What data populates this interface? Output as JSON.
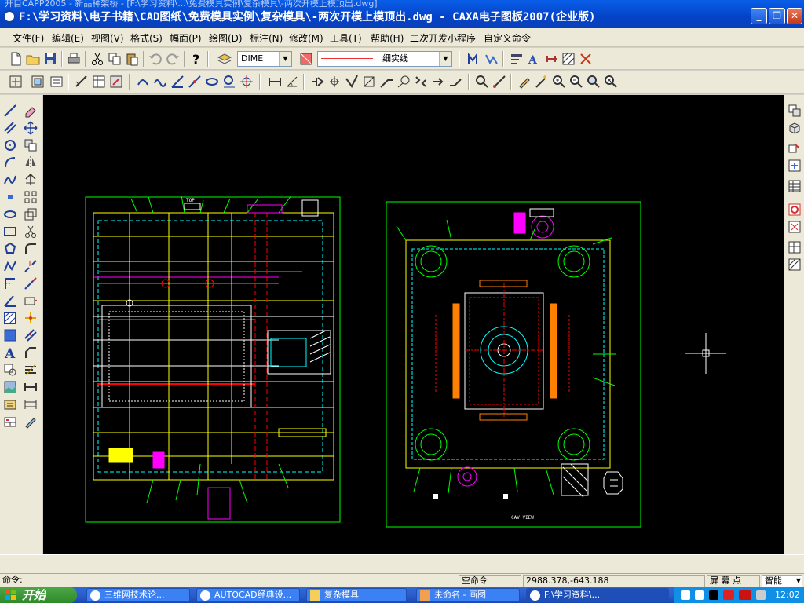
{
  "window": {
    "ghost_title": "开目CAPP2005 - 新品种架桥 - [F:\\学习资料\\...\\免费模具实例\\复杂模具\\-两次开模上模顶出.dwg]",
    "title": "F:\\学习资料\\电子书籍\\CAD图纸\\免费模具实例\\复杂模具\\-两次开模上模顶出.dwg - CAXA电子图板2007(企业版)",
    "minimize": "_",
    "restore": "❐",
    "close": "✕"
  },
  "menu": [
    "文件(F)",
    "编辑(E)",
    "视图(V)",
    "格式(S)",
    "幅面(P)",
    "绘图(D)",
    "标注(N)",
    "修改(M)",
    "工具(T)",
    "帮助(H)",
    "二次开发小程序",
    "自定义命令"
  ],
  "toolbar": {
    "layer_value": "DIME",
    "linetype_value": "细实线"
  },
  "canvas": {
    "right_label_1": "CAV VIEW",
    "left_label": "TOP",
    "colors": {
      "background": "#000000",
      "frame": "#00ff00",
      "lines": "#ffff00",
      "cyan": "#00ffff",
      "red": "#ff0000",
      "magenta": "#ff00ff"
    }
  },
  "status": {
    "command_label": "命令:",
    "empty_command": "空命令",
    "coords": "2988.378,-643.188",
    "screen_point": "屏 幕 点",
    "snap_mode": "智能"
  },
  "taskbar": {
    "start": "开始",
    "tasks": [
      "三维网技术论...",
      "AUTOCAD经典设...",
      "复杂模具",
      "未命名 - 画图",
      "F:\\学习资料\\..."
    ],
    "clock": "12:02"
  }
}
